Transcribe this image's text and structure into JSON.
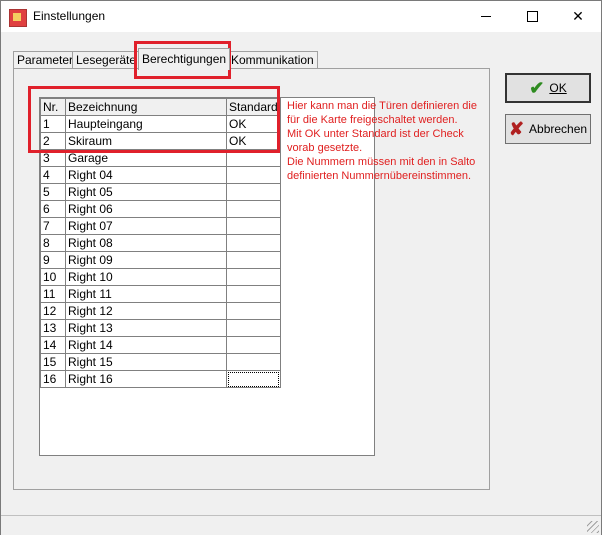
{
  "window": {
    "title": "Einstellungen"
  },
  "tabs": [
    {
      "label": "Parameter"
    },
    {
      "label": "Lesegeräte"
    },
    {
      "label": "Berechtigungen"
    },
    {
      "label": "Kommunikation"
    }
  ],
  "table": {
    "headers": [
      "Nr.",
      "Bezeichnung",
      "Standard"
    ],
    "rows": [
      {
        "nr": "1",
        "name": "Haupteingang",
        "std": "OK"
      },
      {
        "nr": "2",
        "name": "Skiraum",
        "std": "OK"
      },
      {
        "nr": "3",
        "name": "Garage",
        "std": ""
      },
      {
        "nr": "4",
        "name": "Right 04",
        "std": ""
      },
      {
        "nr": "5",
        "name": "Right 05",
        "std": ""
      },
      {
        "nr": "6",
        "name": "Right 06",
        "std": ""
      },
      {
        "nr": "7",
        "name": "Right 07",
        "std": ""
      },
      {
        "nr": "8",
        "name": "Right 08",
        "std": ""
      },
      {
        "nr": "9",
        "name": "Right 09",
        "std": ""
      },
      {
        "nr": "10",
        "name": "Right 10",
        "std": ""
      },
      {
        "nr": "11",
        "name": "Right 11",
        "std": ""
      },
      {
        "nr": "12",
        "name": "Right 12",
        "std": ""
      },
      {
        "nr": "13",
        "name": "Right 13",
        "std": ""
      },
      {
        "nr": "14",
        "name": "Right 14",
        "std": ""
      },
      {
        "nr": "15",
        "name": "Right 15",
        "std": ""
      },
      {
        "nr": "16",
        "name": "Right 16",
        "std": ""
      }
    ]
  },
  "hint": "Hier kann man die Türen definieren die\nfür die Karte freigeschaltet werden.\nMit OK unter Standard ist der Check\nvorab gesetzte.\nDie Nummern müssen mit den in Salto\ndefinierten Nummernübereinstimmen.",
  "buttons": {
    "ok": "OK",
    "cancel": "Abbrechen"
  },
  "colors": {
    "annotation": "#e0202b",
    "hint_text": "#e02020",
    "ok_icon": "#2e8b20",
    "cancel_icon": "#b02020"
  }
}
